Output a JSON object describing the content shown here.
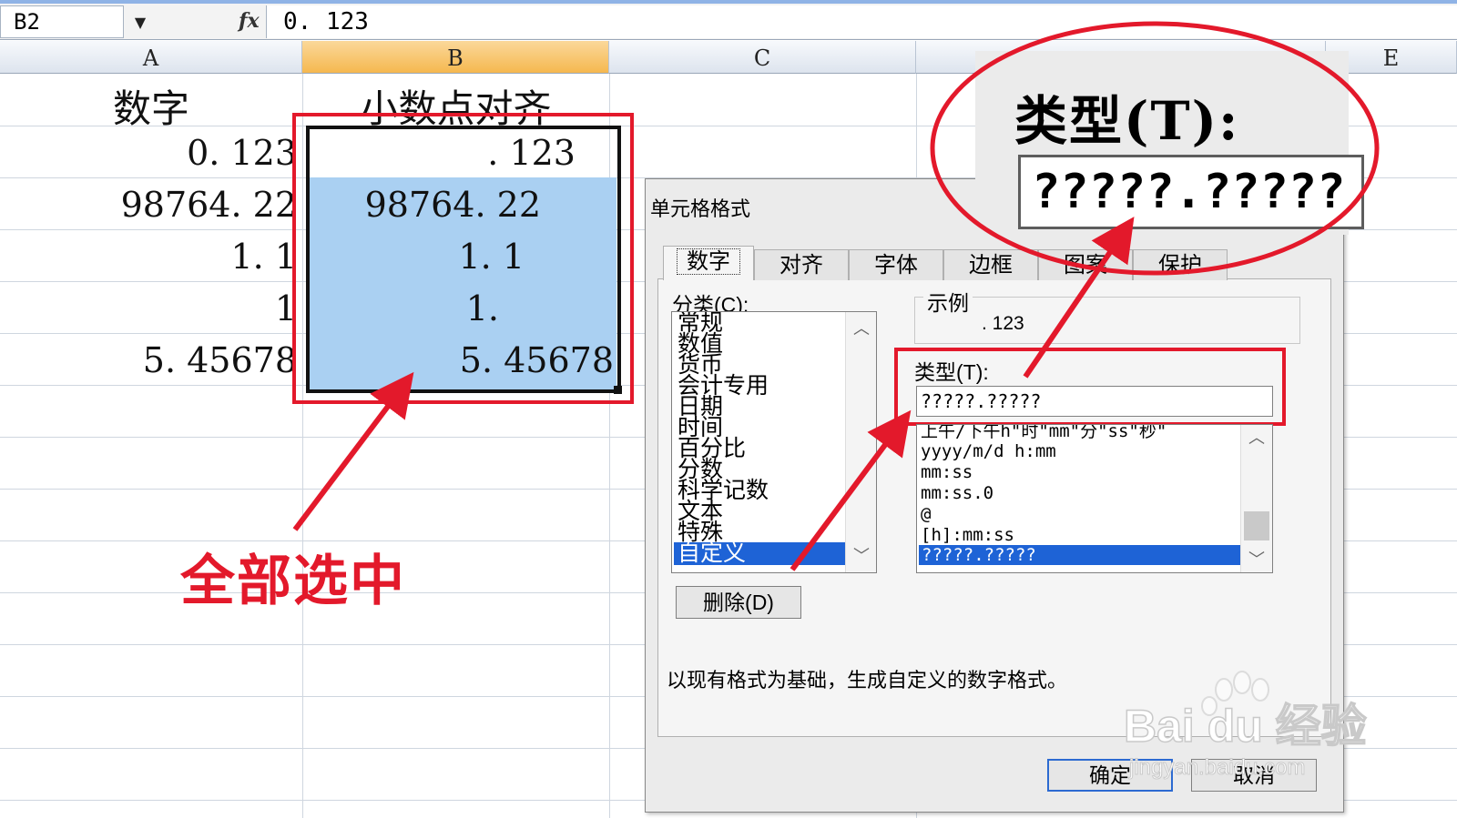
{
  "formula_bar": {
    "name_box": "B2",
    "fx_label": "fx",
    "formula_value": "0. 123"
  },
  "columns": [
    "A",
    "B",
    "C",
    "E"
  ],
  "sheet": {
    "col_a_header": "数字",
    "col_b_header": "小数点对齐",
    "col_a_values": [
      "0. 123",
      "98764. 22",
      "1. 1",
      "1",
      "5. 45678"
    ],
    "col_b_values": [
      ". 123",
      "98764. 22",
      "1. 1",
      "1.",
      "5. 45678"
    ]
  },
  "annotation": {
    "select_all_label": "全部选中",
    "accent_color": "#e3192b"
  },
  "dialog": {
    "title": "单元格格式",
    "tabs": [
      "数字",
      "对齐",
      "字体",
      "边框",
      "图案",
      "保护"
    ],
    "active_tab": "数字",
    "category_label": "分类(C):",
    "categories": [
      "常规",
      "数值",
      "货币",
      "会计专用",
      "日期",
      "时间",
      "百分比",
      "分数",
      "科学记数",
      "文本",
      "特殊",
      "自定义"
    ],
    "selected_category": "自定义",
    "sample_label": "示例",
    "sample_value": ". 123",
    "type_label": "类型(T):",
    "type_value": "?????.?????",
    "format_list": [
      "上午/下午h\"时\"mm\"分\"ss\"秒\"",
      "yyyy/m/d h:mm",
      "mm:ss",
      "mm:ss.0",
      "@",
      "[h]:mm:ss",
      "?????.?????"
    ],
    "selected_format": "?????.?????",
    "delete_label": "删除(D)",
    "description": "以现有格式为基础，生成自定义的数字格式。",
    "ok_label": "确定",
    "cancel_label": "取消"
  },
  "zoom_callout": {
    "type_label": "类型(T):",
    "type_value": "?????.?????"
  },
  "watermark": {
    "brand": "Bai du 经验",
    "url": "jingyan.baidu.com"
  }
}
